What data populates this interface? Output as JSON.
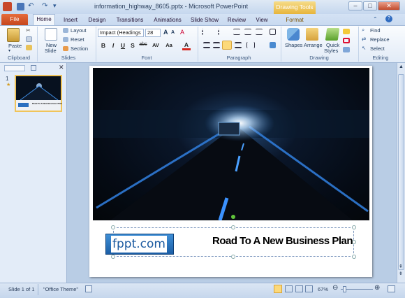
{
  "window": {
    "title": "information_highway_8605.pptx - Microsoft PowerPoint",
    "contextual_tab": "Drawing Tools"
  },
  "tabs": [
    "File",
    "Home",
    "Insert",
    "Design",
    "Transitions",
    "Animations",
    "Slide Show",
    "Review",
    "View",
    "Format"
  ],
  "ribbon": {
    "clipboard": {
      "label": "Clipboard",
      "paste": "Paste"
    },
    "slides": {
      "label": "Slides",
      "new_slide_1": "New",
      "new_slide_2": "Slide",
      "layout": "Layout",
      "reset": "Reset",
      "section": "Section"
    },
    "font": {
      "label": "Font",
      "family": "Impact (Headings",
      "size": "28",
      "buttons": [
        "B",
        "I",
        "U",
        "S",
        "abc",
        "AV",
        "Aa",
        "A"
      ]
    },
    "paragraph": {
      "label": "Paragraph"
    },
    "drawing": {
      "label": "Drawing",
      "shapes": "Shapes",
      "arrange": "Arrange",
      "quick_1": "Quick",
      "quick_2": "Styles"
    },
    "editing": {
      "label": "Editing",
      "find": "Find",
      "replace": "Replace",
      "select": "Select"
    }
  },
  "slides_pane": {
    "slide_number": "1",
    "thumb_title": "Road To A New Business Plan"
  },
  "slide": {
    "logo_text": "fppt.com",
    "headline": "Road To A New Business Plan"
  },
  "status": {
    "slide_info": "Slide 1 of 1",
    "theme": "\"Office Theme\"",
    "zoom": "67%"
  },
  "colors": {
    "file_tab": "#d5562a",
    "accent": "#1b5ea6",
    "contextual": "#e7b53b"
  }
}
